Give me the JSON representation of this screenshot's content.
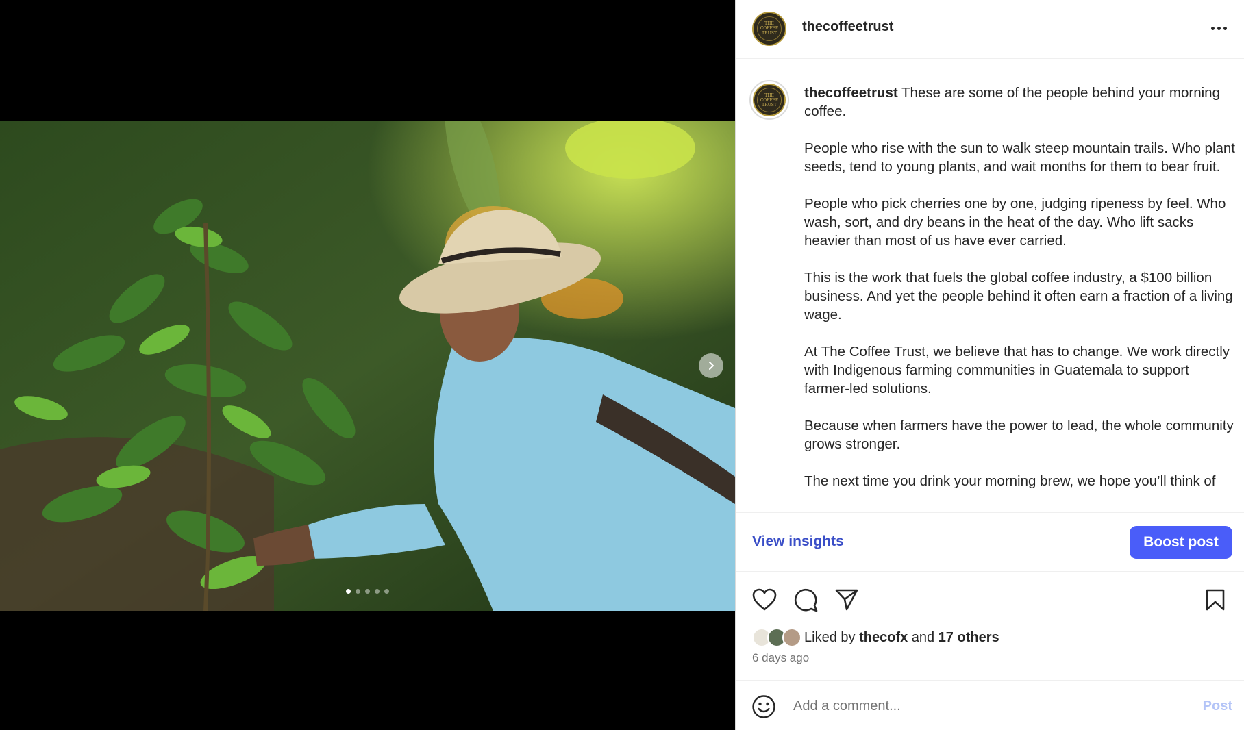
{
  "post": {
    "username": "thecoffeetrust",
    "avatar_text": [
      "THE",
      "COFFEE",
      "TRUST"
    ],
    "media": {
      "slide_count": 5,
      "active_slide": 1,
      "image_description_icon": "photo-farmer-coffee-plant"
    }
  },
  "caption": {
    "username": "thecoffeetrust",
    "first_line": "These are some of the people behind your morning coffee.",
    "paragraphs": [
      "People who rise with the sun to walk steep mountain trails. Who plant seeds, tend to young plants, and wait months for them to bear fruit.",
      "People who pick cherries one by one, judging ripeness by feel. Who wash, sort, and dry beans in the heat of the day. Who lift sacks heavier than most of us have ever carried.",
      "This is the work that fuels the global coffee industry, a $100 billion business. And yet the people behind it often earn a fraction of a living wage.",
      "At The Coffee Trust, we believe that has to change. We work directly with Indigenous farming communities in Guatemala to support farmer-led solutions.",
      "Because when farmers have the power to lead, the whole community grows stronger.",
      "The next time you drink your morning brew, we hope you’ll think of"
    ]
  },
  "insights": {
    "view_label": "View insights",
    "boost_label": "Boost post"
  },
  "likes": {
    "prefix": "Liked by",
    "first_user": "thecofx",
    "conjunction": "and",
    "others": "17 others"
  },
  "timestamp": "6 days ago",
  "comment": {
    "placeholder": "Add a comment...",
    "post_label": "Post"
  },
  "colors": {
    "accent": "#4a5df9",
    "link": "#3a4ec7",
    "post_disabled": "#b3c4f7",
    "avatar_gold": "#b59a3c"
  }
}
